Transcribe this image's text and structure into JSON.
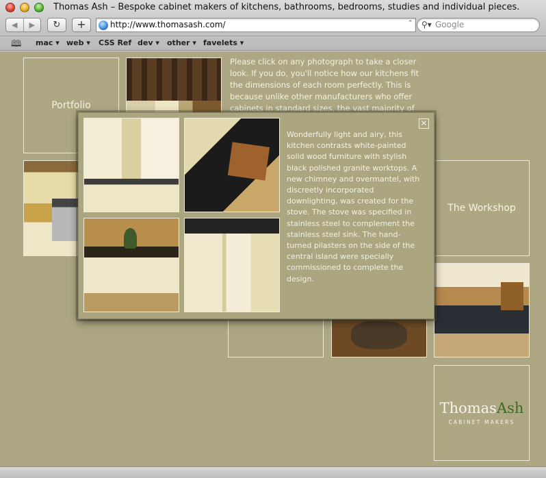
{
  "window": {
    "title": "Thomas Ash – Bespoke cabinet makers of kitchens, bathrooms, bedrooms, studies and individual pieces."
  },
  "toolbar": {
    "back_icon": "back-arrow-icon",
    "forward_icon": "forward-arrow-icon",
    "reload_icon": "reload-icon",
    "add_bookmark_icon": "plus-icon",
    "url": "http://www.thomasash.com/",
    "search_placeholder": "Google"
  },
  "bookmarks": {
    "items": [
      "mac ▾",
      "web ▾",
      "CSS Ref",
      "dev ▾",
      "other ▾",
      "favelets ▾"
    ]
  },
  "page": {
    "background": "#ada883",
    "tiles": {
      "portfolio": "Portfolio",
      "workshop": "The Workshop"
    },
    "intro": "Please click on any photograph to take a closer look. If you do, you'll notice how our kitchens fit the dimensions of each room perfectly. This is because unlike other manufacturers who offer cabinets in standard sizes, the vast majority of ours are made to",
    "logo": {
      "first": "Thomas",
      "second": "Ash",
      "subtitle": "CABINET MAKERS",
      "accent": "#3e6a1f"
    }
  },
  "lightbox": {
    "description": "Wonderfully light and airy, this kitchen contrasts white-painted solid wood furniture with stylish black polished granite worktops. A new chimney and overmantel, with discreetly incorporated downlighting, was created for the stove. The stove was specified in stainless steel to complement the stainless steel sink. The hand-turned pilasters on the side of the central island were specially commissioned to complete the design.",
    "close_icon": "close-icon"
  }
}
